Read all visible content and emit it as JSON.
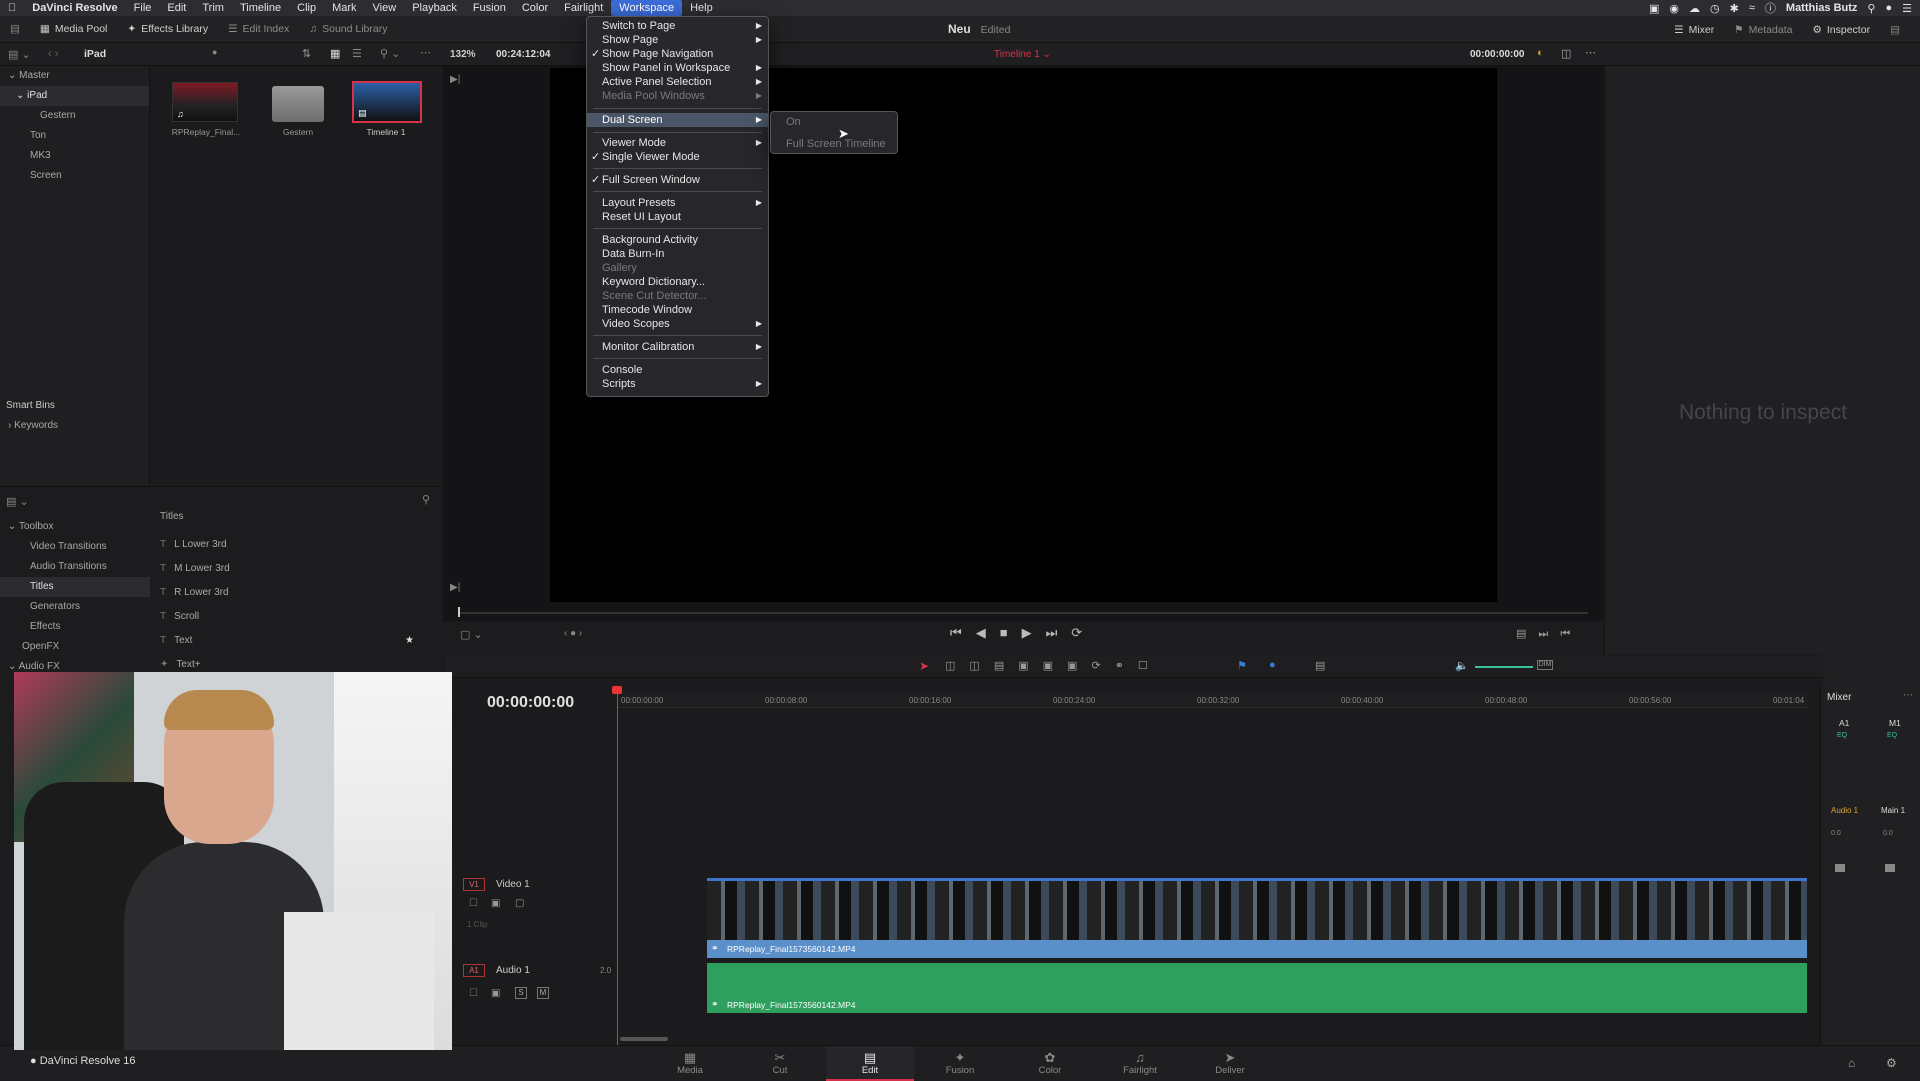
{
  "menubar": {
    "items": [
      "DaVinci Resolve",
      "File",
      "Edit",
      "Trim",
      "Timeline",
      "Clip",
      "Mark",
      "View",
      "Playback",
      "Fusion",
      "Color",
      "Fairlight",
      "Workspace",
      "Help"
    ],
    "user": "Matthias Butz"
  },
  "toolbar": {
    "media_pool": "Media Pool",
    "effects_library": "Effects Library",
    "edit_index": "Edit Index",
    "sound_library": "Sound Library",
    "project_name": "Neu",
    "project_status": "Edited",
    "mixer": "Mixer",
    "metadata": "Metadata",
    "inspector": "Inspector"
  },
  "subbar": {
    "bin_name": "iPad",
    "zoom": "132%",
    "source_tc": "00:24:12:04",
    "timeline_name": "Timeline 1",
    "record_tc": "00:00:00:00"
  },
  "media_tree": {
    "master": "Master",
    "items": [
      "iPad",
      "Gestern",
      "Ton",
      "MK3",
      "Screen"
    ],
    "smart_bins": "Smart Bins",
    "keywords": "Keywords"
  },
  "thumbnails": [
    {
      "label": "RPReplay_Final..."
    },
    {
      "label": "Gestern"
    },
    {
      "label": "Timeline 1"
    }
  ],
  "workspace_menu": {
    "items": [
      {
        "label": "Switch to Page",
        "sub": true
      },
      {
        "label": "Show Page",
        "sub": true
      },
      {
        "label": "Show Page Navigation",
        "check": true
      },
      {
        "label": "Show Panel in Workspace",
        "sub": true
      },
      {
        "label": "Active Panel Selection",
        "sub": true
      },
      {
        "label": "Media Pool Windows",
        "sub": true,
        "disabled": true
      },
      {
        "label": "Dual Screen",
        "sub": true,
        "highlight": true
      },
      {
        "label": "Viewer Mode",
        "sub": true
      },
      {
        "label": "Single Viewer Mode",
        "check": true
      },
      {
        "label": "Full Screen Window",
        "check": true
      },
      {
        "label": "Layout Presets",
        "sub": true
      },
      {
        "label": "Reset UI Layout"
      },
      {
        "label": "Background Activity"
      },
      {
        "label": "Data Burn-In"
      },
      {
        "label": "Gallery",
        "disabled": true
      },
      {
        "label": "Keyword Dictionary..."
      },
      {
        "label": "Scene Cut Detector...",
        "disabled": true
      },
      {
        "label": "Timecode Window"
      },
      {
        "label": "Video Scopes",
        "sub": true
      },
      {
        "label": "Monitor Calibration",
        "sub": true
      },
      {
        "label": "Console"
      },
      {
        "label": "Scripts",
        "sub": true
      }
    ],
    "dual_screen_sub": [
      "On",
      "Full Screen Timeline"
    ]
  },
  "inspector": {
    "empty": "Nothing to inspect"
  },
  "effects": {
    "section_title": "Titles",
    "toolbox": "Toolbox",
    "tree": [
      "Video Transitions",
      "Audio Transitions",
      "Titles",
      "Generators",
      "Effects"
    ],
    "openfx": "OpenFX",
    "audiofx": "Audio FX",
    "titles": [
      "L Lower 3rd",
      "M Lower 3rd",
      "R Lower 3rd",
      "Scroll",
      "Text",
      "Text+"
    ]
  },
  "timeline": {
    "timecode": "00:00:00:00",
    "ruler": [
      "00:00:00:00",
      "00:00:08:00",
      "00:00:16:00",
      "00:00:24:00",
      "00:00:32:00",
      "00:00:40:00",
      "00:00:48:00",
      "00:00:56:00",
      "00:01:04"
    ],
    "video_track": {
      "id": "V1",
      "name": "Video 1",
      "clips": "1 Clip"
    },
    "audio_track": {
      "id": "A1",
      "name": "Audio 1",
      "level": "2.0"
    },
    "clip_name": "RPReplay_Final1573560142.MP4"
  },
  "mixer": {
    "title": "Mixer",
    "a1": "A1",
    "m1": "M1",
    "audio1": "Audio 1",
    "main1": "Main 1",
    "eq": "EQ",
    "a1_level": "0.0",
    "m1_level": "0.0"
  },
  "pages": [
    "Media",
    "Cut",
    "Edit",
    "Fusion",
    "Color",
    "Fairlight",
    "Deliver"
  ],
  "footer": {
    "app_label": "DaVinci Resolve 16"
  },
  "colors": {
    "accent": "#d6334a",
    "menu_highlight": "#4a5568",
    "video_clip": "#5b8fc9",
    "audio_clip": "#2e9f5e"
  }
}
